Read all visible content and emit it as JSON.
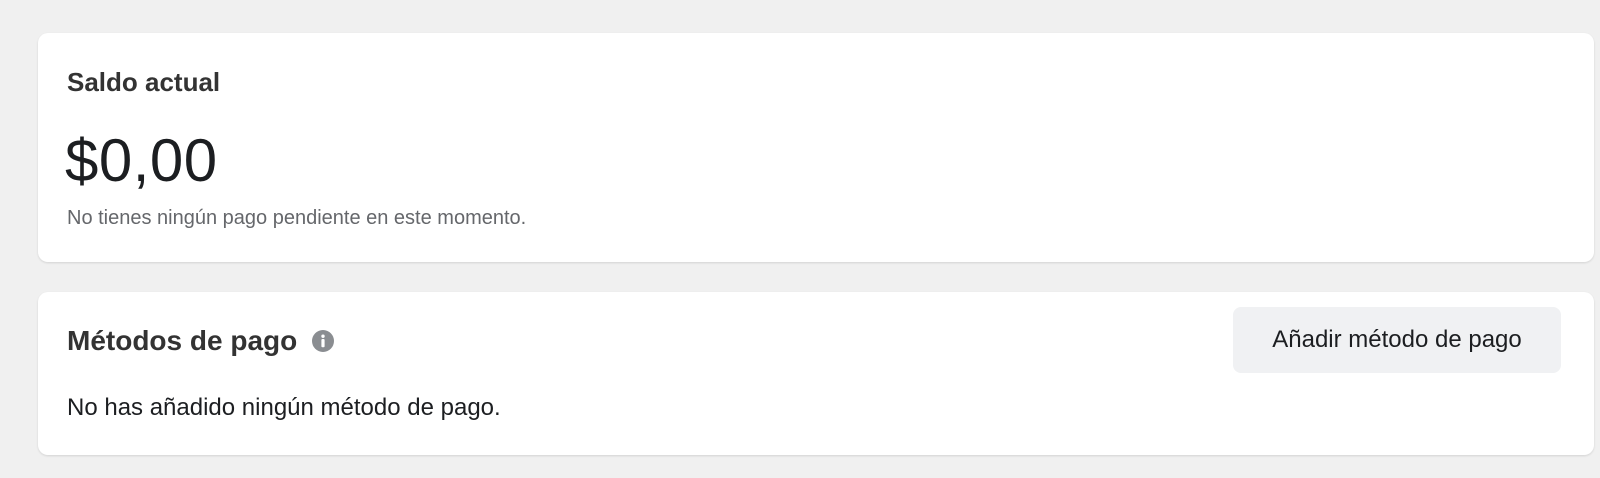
{
  "balance": {
    "title": "Saldo actual",
    "amount": "$0,00",
    "note": "No tienes ningún pago pendiente en este momento."
  },
  "payment_methods": {
    "title": "Métodos de pago",
    "info_icon": "info-icon",
    "add_button_label": "Añadir método de pago",
    "empty_message": "No has añadido ningún método de pago."
  },
  "colors": {
    "page_background": "#f0f0f0",
    "card_background": "#ffffff",
    "title_text": "#333333",
    "primary_text": "#1c1e21",
    "secondary_text": "#65676b",
    "button_background": "#f0f1f3",
    "icon_gray": "#8a8d91"
  }
}
